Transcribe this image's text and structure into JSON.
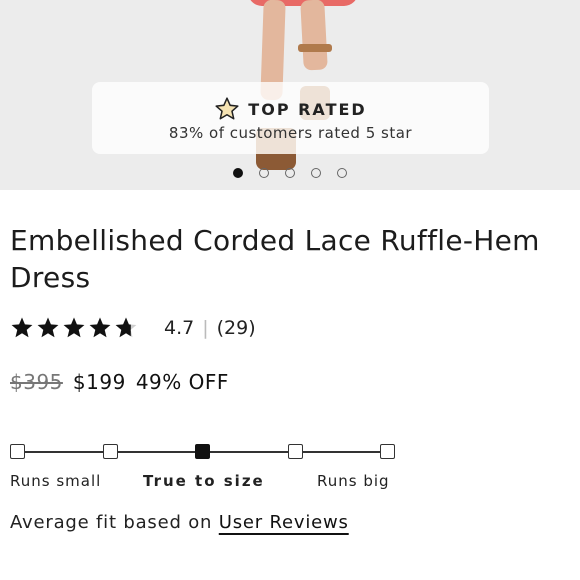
{
  "hero": {
    "badge": {
      "icon": "star-outline-icon",
      "title": "TOP RATED",
      "subtitle": "83% of customers rated 5 star"
    },
    "carousel": {
      "total": 5,
      "active_index": 0
    }
  },
  "product": {
    "title": "Embellished Corded Lace Ruffle-Hem Dress",
    "rating": {
      "stars_value": 4.7,
      "value_text": "4.7",
      "separator": "|",
      "count_text": "(29)"
    },
    "price": {
      "original": "$395",
      "sale": "$199",
      "discount": "49% OFF"
    }
  },
  "fit": {
    "positions": 5,
    "selected_index": 2,
    "labels": {
      "small": "Runs small",
      "true": "True to size",
      "big": "Runs big"
    },
    "summary_text": "Average fit based on",
    "summary_link": "User Reviews"
  },
  "colors": {
    "badge_star": "#f5e3b3",
    "text": "#1a1a1a",
    "muted": "#777777"
  }
}
